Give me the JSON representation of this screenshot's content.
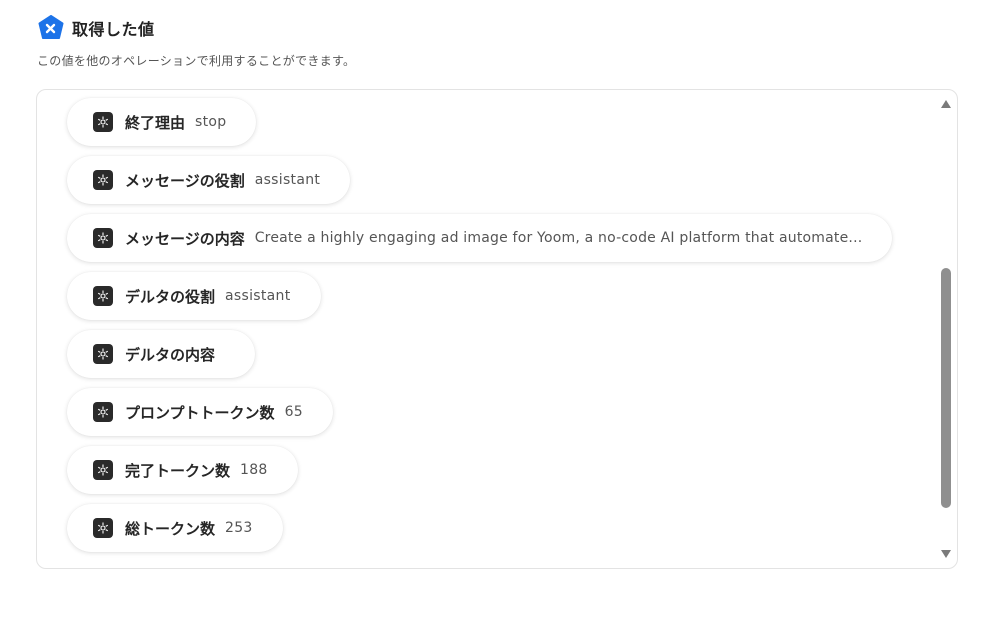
{
  "header": {
    "title": "取得した値",
    "description": "この値を他のオペレーションで利用することができます。",
    "icon": "yoom-logo-icon",
    "accent_color": "#1d73e8"
  },
  "items": [
    {
      "label": "終了理由",
      "value": "stop",
      "icon": "openai-icon"
    },
    {
      "label": "メッセージの役割",
      "value": "assistant",
      "icon": "openai-icon"
    },
    {
      "label": "メッセージの内容",
      "value": "Create a highly engaging ad image for Yoom, a no-code AI platform that automate...",
      "icon": "openai-icon"
    },
    {
      "label": "デルタの役割",
      "value": "assistant",
      "icon": "openai-icon"
    },
    {
      "label": "デルタの内容",
      "value": "",
      "icon": "openai-icon"
    },
    {
      "label": "プロンプトトークン数",
      "value": "65",
      "icon": "openai-icon"
    },
    {
      "label": "完了トークン数",
      "value": "188",
      "icon": "openai-icon"
    },
    {
      "label": "総トークン数",
      "value": "253",
      "icon": "openai-icon"
    }
  ]
}
